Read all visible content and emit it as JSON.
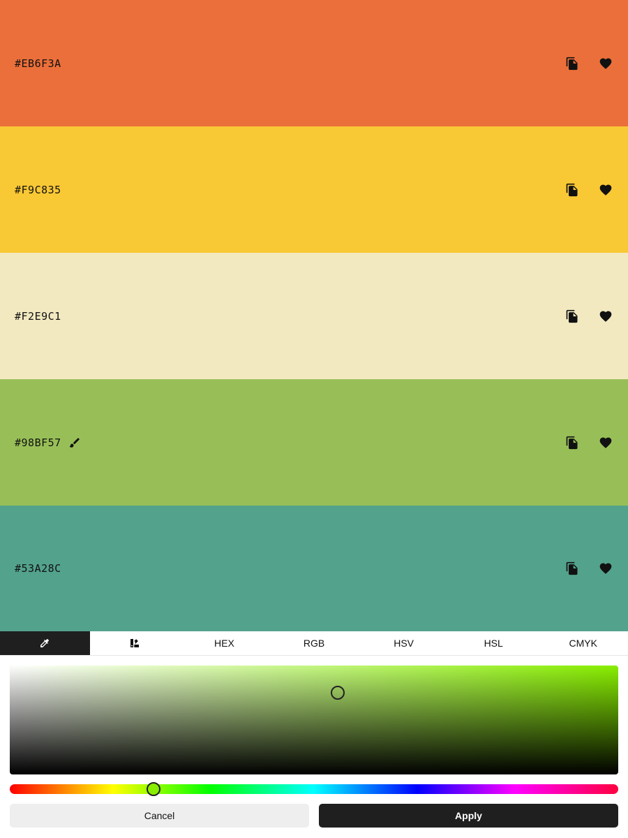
{
  "swatches": [
    {
      "hex": "#EB6F3A",
      "color": "#EB6F3A",
      "editing": false
    },
    {
      "hex": "#F9C835",
      "color": "#F9C835",
      "editing": false
    },
    {
      "hex": "#F2E9C1",
      "color": "#F2E9C1",
      "editing": false
    },
    {
      "hex": "#98BF57",
      "color": "#98BF57",
      "editing": true
    },
    {
      "hex": "#53A28C",
      "color": "#53A28C",
      "editing": false
    }
  ],
  "icons": {
    "copy": "copy-icon",
    "heart": "heart-icon",
    "brush": "brush-icon",
    "eyedropper": "eyedropper-icon",
    "palette": "palette-icon"
  },
  "tabs": {
    "hex": "HEX",
    "rgb": "RGB",
    "hsv": "HSV",
    "hsl": "HSL",
    "cmyk": "CMYK",
    "active": "eyedropper"
  },
  "picker": {
    "hue_color": "#88EE00",
    "saturation": 0.54,
    "value": 0.75,
    "hue_position": 0.24
  },
  "buttons": {
    "cancel": "Cancel",
    "apply": "Apply"
  },
  "colors": {
    "dark": "#1F1F1F",
    "light_button": "#EEEEEE"
  }
}
